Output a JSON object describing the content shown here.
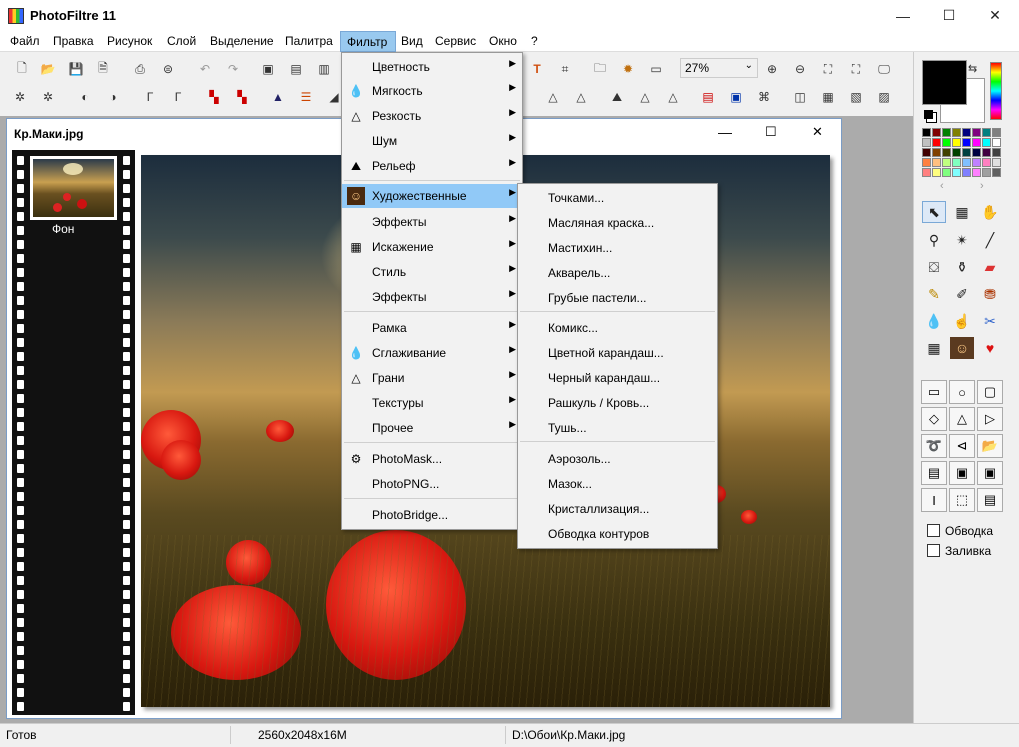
{
  "app": {
    "title": "PhotoFiltre 11"
  },
  "window_controls": {
    "minimize": "—",
    "maximize": "☐",
    "close": "✕"
  },
  "menubar": [
    "Файл",
    "Правка",
    "Рисунок",
    "Слой",
    "Выделение",
    "Палитра",
    "Фильтр",
    "Вид",
    "Сервис",
    "Окно",
    "?"
  ],
  "toolbar": {
    "zoom": "27%"
  },
  "document": {
    "title": "Кр.Маки.jpg",
    "layer_label": "Фон"
  },
  "filter_menu": {
    "items": [
      {
        "label": "Цветность",
        "submenu": true
      },
      {
        "label": "Мягкость",
        "submenu": true,
        "icon": "drop-icon"
      },
      {
        "label": "Резкость",
        "submenu": true,
        "icon": "triangle-drop-icon"
      },
      {
        "label": "Шум",
        "submenu": true
      },
      {
        "label": "Рельеф",
        "submenu": true,
        "icon": "mountain-icon"
      },
      {
        "label": "Художественные",
        "submenu": true,
        "icon": "portrait-icon",
        "highlighted": true
      },
      {
        "label": "Эффекты",
        "submenu": true
      },
      {
        "label": "Искажение",
        "submenu": true,
        "icon": "grid-warp-icon"
      },
      {
        "label": "Стиль",
        "submenu": true
      },
      {
        "label": "Эффекты",
        "submenu": true
      },
      {
        "label": "Рамка",
        "submenu": true
      },
      {
        "label": "Сглаживание",
        "submenu": true,
        "icon": "drop-icon"
      },
      {
        "label": "Грани",
        "submenu": true,
        "icon": "triangle-drop-icon"
      },
      {
        "label": "Текстуры",
        "submenu": true
      },
      {
        "label": "Прочее",
        "submenu": true
      },
      {
        "label": "PhotoMask...",
        "icon": "photomask-icon"
      },
      {
        "label": "PhotoPNG..."
      },
      {
        "label": "PhotoBridge..."
      }
    ]
  },
  "artistic_submenu": {
    "items": [
      "Точками...",
      "Масляная краска...",
      "Мастихин...",
      "Акварель...",
      "Грубые пастели...",
      "Комикс...",
      "Цветной карандаш...",
      "Черный карандаш...",
      "Рашкуль / Кровь...",
      "Тушь...",
      "Аэрозоль...",
      "Мазок...",
      "Кристаллизация...",
      "Обводка контуров"
    ]
  },
  "right_panel": {
    "checkboxes": [
      {
        "label": "Обводка",
        "checked": false
      },
      {
        "label": "Заливка",
        "checked": false
      }
    ]
  },
  "statusbar": {
    "status": "Готов",
    "image_info": "2560x2048x16M",
    "path": "D:\\Обои\\Кр.Маки.jpg"
  }
}
